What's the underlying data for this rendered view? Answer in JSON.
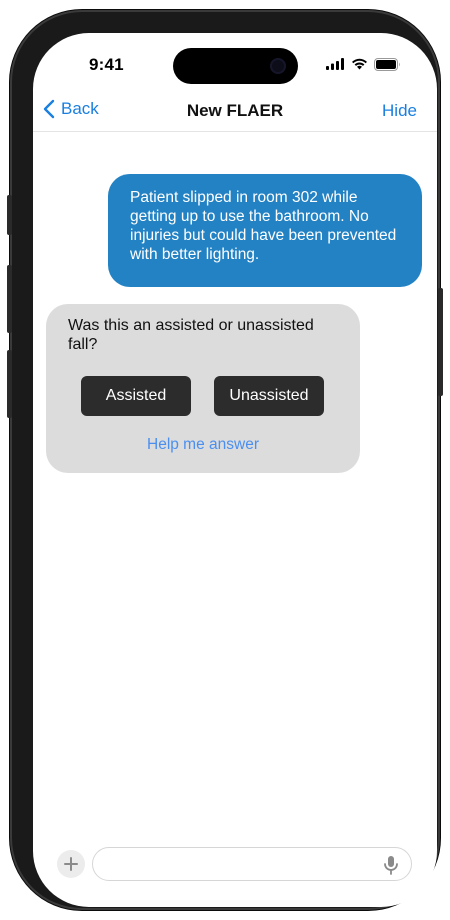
{
  "status_bar": {
    "time": "9:41"
  },
  "nav": {
    "back_label": "Back",
    "title": "New FLAER",
    "hide_label": "Hide"
  },
  "messages": {
    "outgoing": "Patient slipped in room 302 while getting up to use the bathroom. No injuries but could have been prevented with better lighting.",
    "incoming": {
      "question": "Was this an assisted or unassisted fall?",
      "options": [
        "Assisted",
        "Unassisted"
      ],
      "help_label": "Help me answer"
    }
  },
  "composer": {
    "placeholder": ""
  },
  "icons": {
    "back": "chevron-left-icon",
    "signal": "cellular-signal-icon",
    "wifi": "wifi-icon",
    "battery": "battery-icon",
    "add": "plus-icon",
    "mic": "microphone-icon"
  },
  "colors": {
    "accent": "#1a7fe0",
    "outgoing_bubble": "#2282c4",
    "incoming_bubble": "#dcdcdc",
    "answer_button": "#2c2c2c",
    "help_link": "#4a8ff0"
  }
}
